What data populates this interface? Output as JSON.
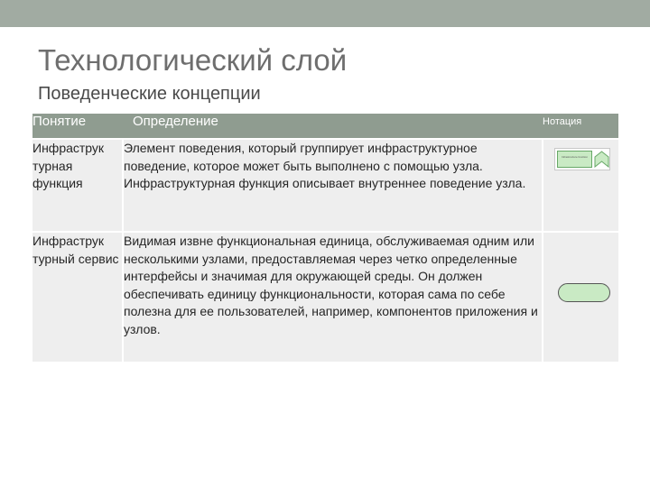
{
  "slide": {
    "title": "Технологический слой",
    "subtitle": "Поведенческие концепции"
  },
  "table": {
    "headers": {
      "concept": "Понятие",
      "definition": "Определение",
      "notation": "Нотация"
    },
    "rows": [
      {
        "concept": "Инфраструк турная функция",
        "definition": "Элемент поведения, который группирует инфраструктурное поведение, которое может быть выполнено с помощью узла. Инфраструктурная функция описывает внутреннее поведение узла.",
        "notation_symbol": "infrastructure-function-symbol",
        "notation_label": "Infrastructure function"
      },
      {
        "concept": "Инфраструк турный сервис",
        "definition": "Видимая извне функциональная единица, обслуживаемая одним или несколькими узлами, предоставляемая через четко определенные интерфейсы и значимая для окружающей среды. Он должен обеспечивать единицу функциональности, которая сама по себе полезна для ее пользователей, например, компонентов приложения и узлов.",
        "notation_symbol": "infrastructure-service-symbol"
      }
    ]
  },
  "colors": {
    "topbar": "#a1aba2",
    "header": "#8f9c90",
    "row_bg": "#eeeeee",
    "notation_fill": "#c9eac4"
  }
}
